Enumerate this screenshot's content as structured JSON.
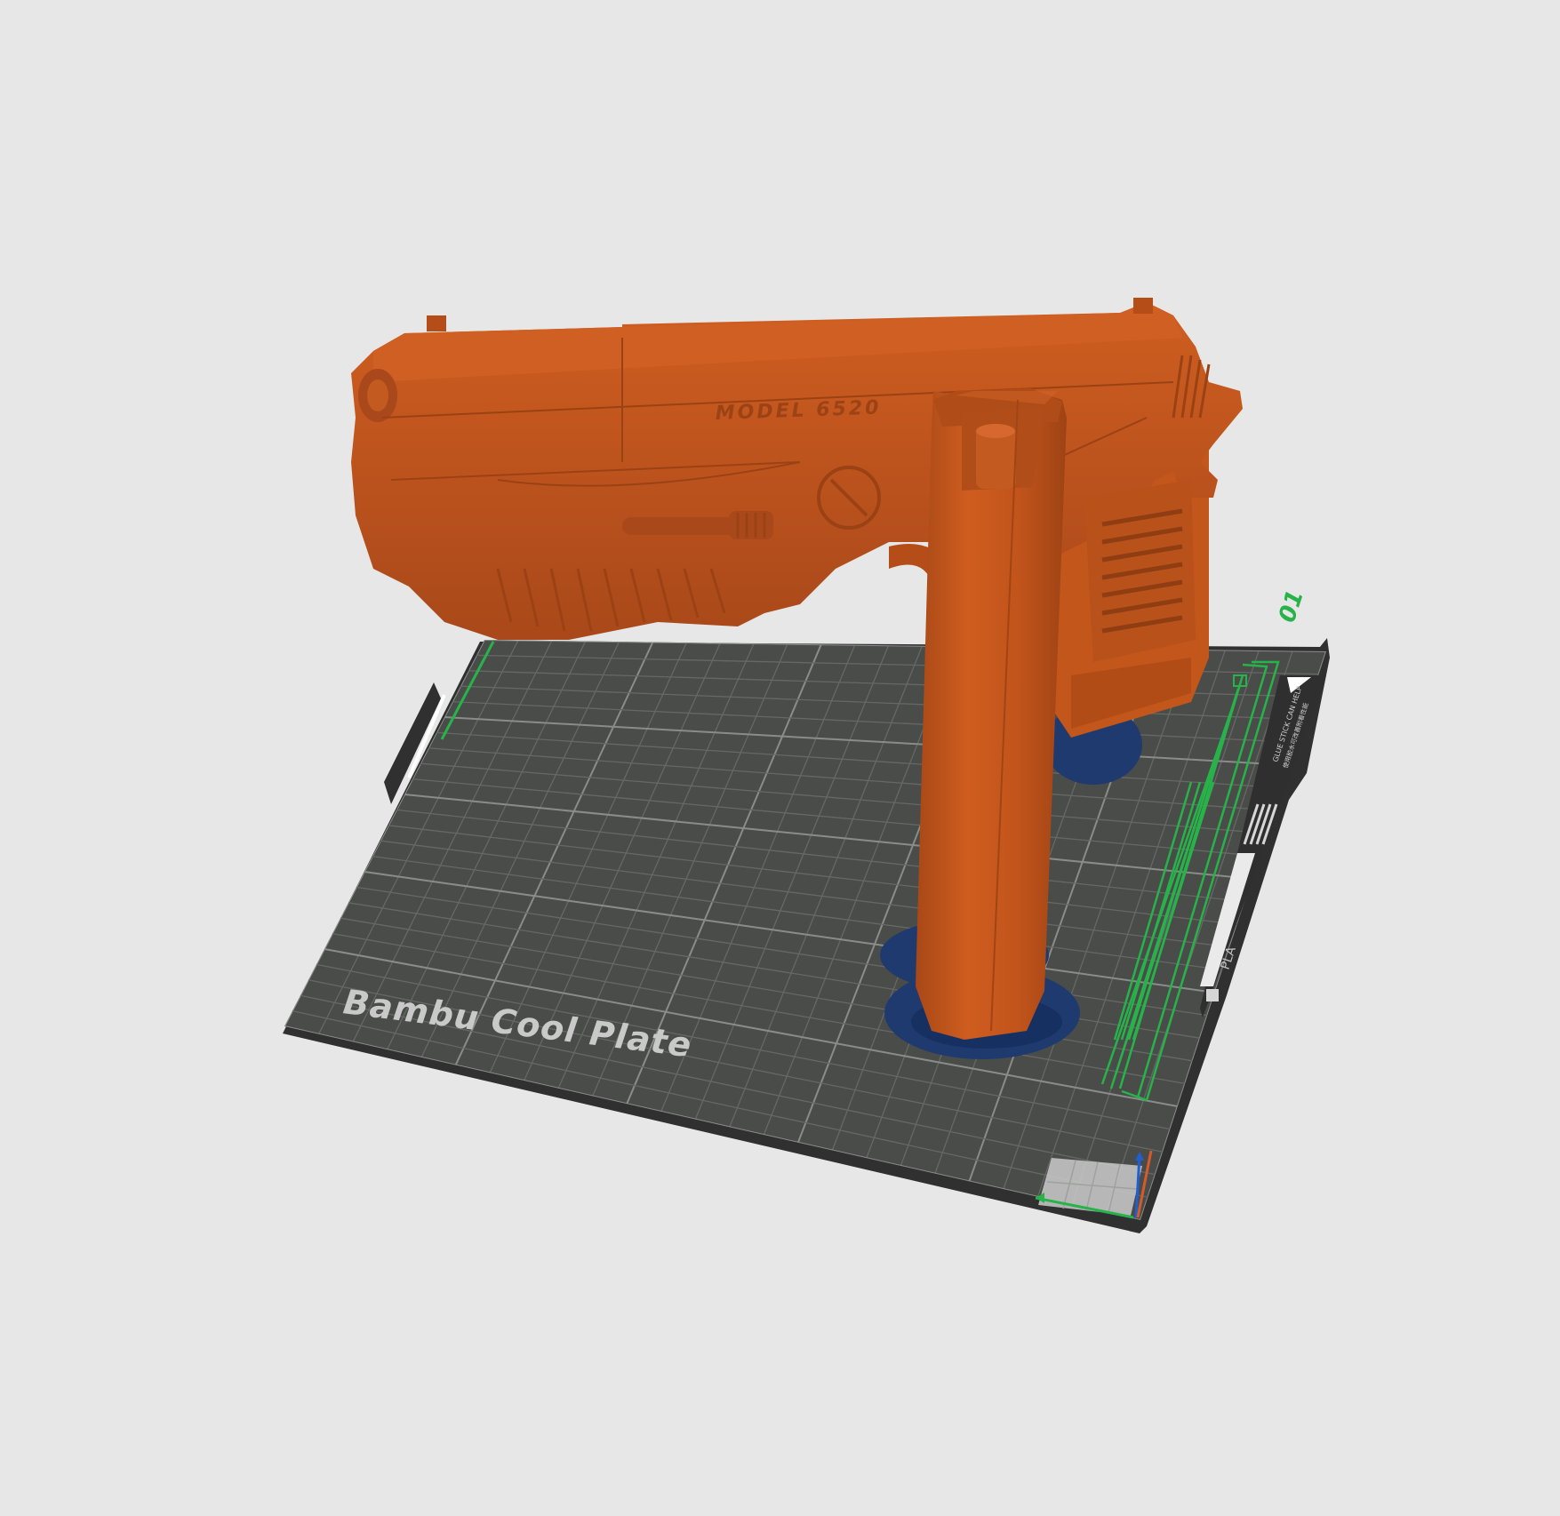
{
  "viewport": {
    "background": "#e7e7e7",
    "plate": {
      "name": "Bambu Cool Plate",
      "number": "01",
      "filament_label": "PLA",
      "stripe_text_1": "GLUE STICK CAN HELP",
      "stripe_text_2": "使用胶水可改善附着性能",
      "colors": {
        "plate": "#4a4c4a",
        "grid": "#6d6f6d",
        "frame": "#2e2f2e",
        "accent_green": "#27b34a"
      }
    },
    "model": {
      "engraving": "MODEL 6520",
      "colors": {
        "body": "#c8581c",
        "shade": "#a94815",
        "support_base": "#1e3a6e"
      }
    },
    "axes": {
      "x_color": "#27b34a",
      "y_color": "#1f5fd0",
      "z_color": "#d65a2a"
    }
  }
}
